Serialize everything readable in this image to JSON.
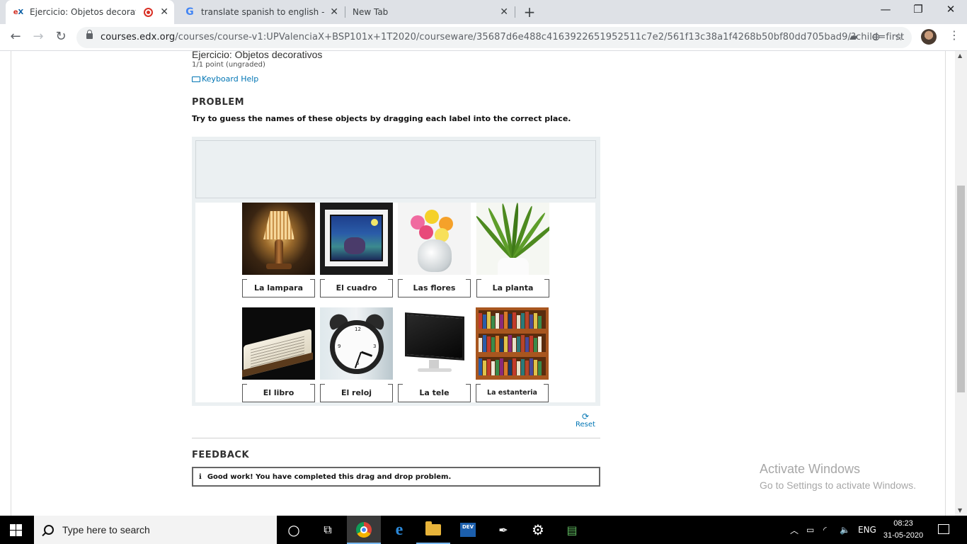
{
  "browser": {
    "tabs": [
      {
        "title": "Ejercicio: Objetos decorativo",
        "favicon": "edx",
        "active": true,
        "recording": true
      },
      {
        "title": "translate spanish to english - Goo",
        "favicon": "google",
        "active": false
      },
      {
        "title": "New Tab",
        "favicon": "",
        "active": false
      }
    ],
    "url_host": "courses.edx.org",
    "url_path": "/courses/course-v1:UPValenciaX+BSP101x+1T2020/courseware/35687d6e488c4163922651952511c7e2/561f13c38a1f4268b50bf80dd705bad9/?child=first"
  },
  "problem": {
    "title": "Ejercicio: Objetos decorativos",
    "points": "1/1 point (ungraded)",
    "keyboard_help": "Keyboard Help",
    "section_heading": "PROBLEM",
    "instructions": "Try to guess the names of these objects by dragging each label into the correct place.",
    "items": [
      {
        "label": "La lampara",
        "image": "lamp"
      },
      {
        "label": "El cuadro",
        "image": "painting"
      },
      {
        "label": "Las flores",
        "image": "flowers"
      },
      {
        "label": "La planta",
        "image": "plant"
      },
      {
        "label": "El libro",
        "image": "book"
      },
      {
        "label": "El reloj",
        "image": "clock"
      },
      {
        "label": "La tele",
        "image": "monitor"
      },
      {
        "label": "La estanteria",
        "image": "bookshelf"
      }
    ],
    "reset_label": "Reset",
    "feedback_heading": "FEEDBACK",
    "feedback_message": "Good work! You have completed this drag and drop problem."
  },
  "watermark": {
    "line1": "Activate Windows",
    "line2": "Go to Settings to activate Windows."
  },
  "taskbar": {
    "search_placeholder": "Type here to search",
    "language": "ENG",
    "time": "08:23",
    "date": "31-05-2020"
  }
}
